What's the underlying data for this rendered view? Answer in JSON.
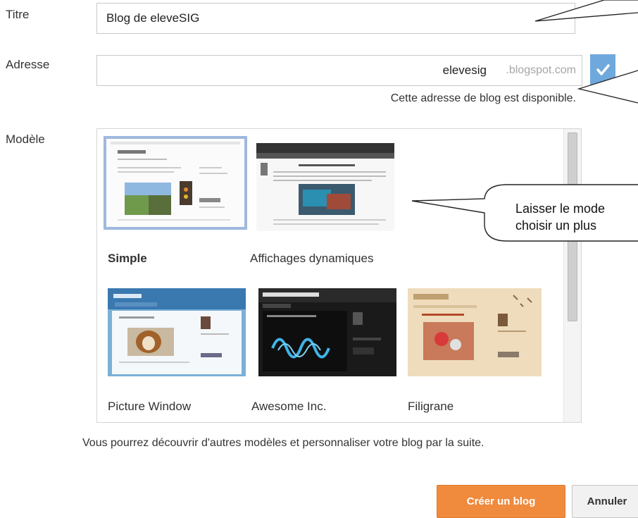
{
  "form": {
    "title_label": "Titre",
    "title_value": "Blog de eleveSIG",
    "address_label": "Adresse",
    "address_value": "elevesig",
    "address_suffix": ".blogspot.com",
    "availability": "Cette adresse de blog est disponible.",
    "template_label": "Modèle"
  },
  "templates": [
    {
      "name": "Simple",
      "selected": true
    },
    {
      "name": "Affichages dynamiques",
      "selected": false
    },
    {
      "name": "Picture Window",
      "selected": false
    },
    {
      "name": "Awesome Inc.",
      "selected": false
    },
    {
      "name": "Filigrane",
      "selected": false
    }
  ],
  "note": "Vous pourrez découvrir d'autres modèles et personnaliser votre blog par la suite.",
  "buttons": {
    "create": "Créer un blog",
    "cancel": "Annuler"
  },
  "callout": {
    "line1": "Laisser le mode",
    "line2": "choisir un plus"
  },
  "colors": {
    "accent": "#f08a3c",
    "check": "#6fa8dc",
    "selected_border": "#9fb8dd"
  }
}
